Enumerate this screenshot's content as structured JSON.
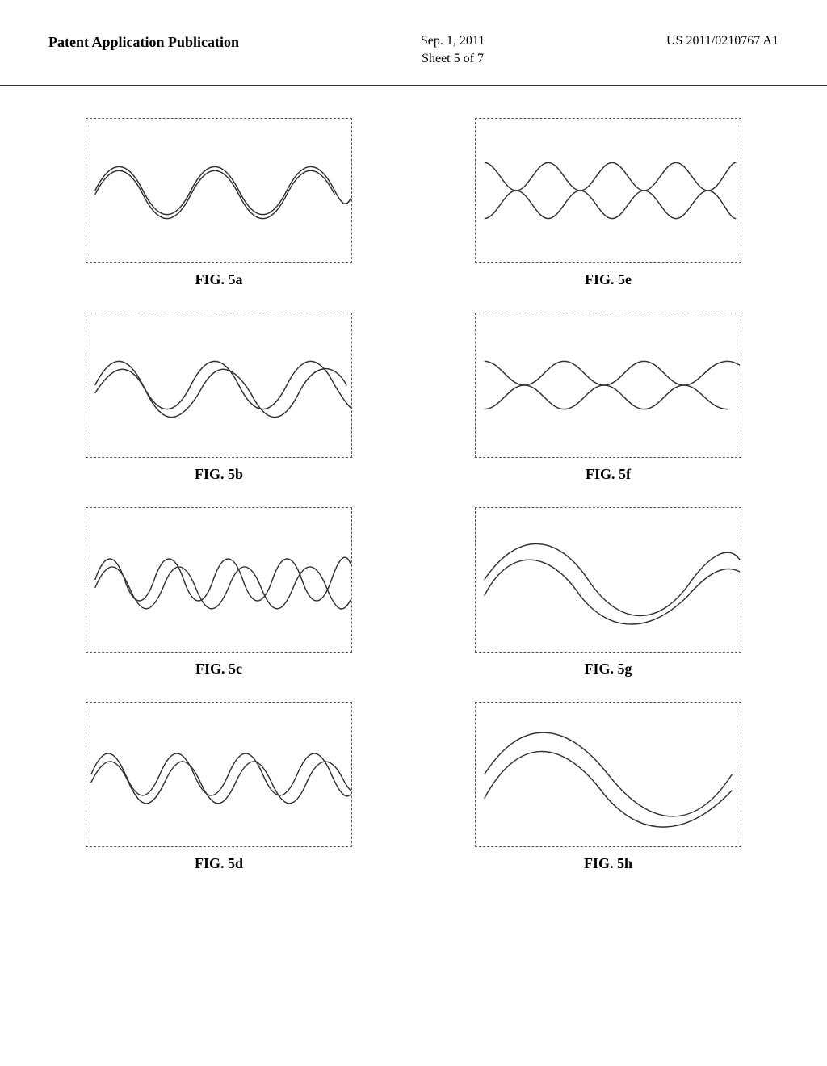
{
  "header": {
    "left": "Patent Application Publication",
    "center_date": "Sep. 1, 2011",
    "center_sheet": "Sheet 5 of 7",
    "right": "US 2011/0210767 A1"
  },
  "figures": [
    {
      "id": "fig5a",
      "label": "FIG. 5a",
      "wave_type": "two_wave_equal"
    },
    {
      "id": "fig5e",
      "label": "FIG. 5e",
      "wave_type": "high_freq_cross"
    },
    {
      "id": "fig5b",
      "label": "FIG. 5b",
      "wave_type": "two_wave_slight_diff"
    },
    {
      "id": "fig5f",
      "label": "FIG. 5f",
      "wave_type": "two_wave_cross_medium"
    },
    {
      "id": "fig5c",
      "label": "FIG. 5c",
      "wave_type": "two_wave_high_freq"
    },
    {
      "id": "fig5g",
      "label": "FIG. 5g",
      "wave_type": "two_wave_low_freq"
    },
    {
      "id": "fig5d",
      "label": "FIG. 5d",
      "wave_type": "two_wave_medium_cross"
    },
    {
      "id": "fig5h",
      "label": "FIG. 5h",
      "wave_type": "two_wave_very_low"
    }
  ]
}
